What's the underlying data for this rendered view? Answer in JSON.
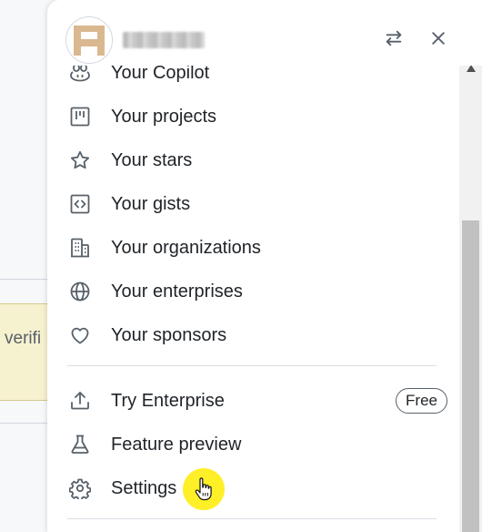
{
  "background": {
    "banner_text": "verifi"
  },
  "header": {
    "username": "",
    "switch_icon": "arrows-switch-icon",
    "close_icon": "close-icon"
  },
  "menu": {
    "items": [
      {
        "label": "Your Copilot",
        "icon": "copilot-icon"
      },
      {
        "label": "Your projects",
        "icon": "project-board-icon"
      },
      {
        "label": "Your stars",
        "icon": "star-icon"
      },
      {
        "label": "Your gists",
        "icon": "code-square-icon"
      },
      {
        "label": "Your organizations",
        "icon": "organization-icon"
      },
      {
        "label": "Your enterprises",
        "icon": "globe-icon"
      },
      {
        "label": "Your sponsors",
        "icon": "heart-icon"
      }
    ],
    "items2": [
      {
        "label": "Try Enterprise",
        "icon": "upload-icon",
        "badge": "Free"
      },
      {
        "label": "Feature preview",
        "icon": "beaker-icon"
      },
      {
        "label": "Settings",
        "icon": "gear-icon"
      }
    ]
  },
  "colors": {
    "text": "#1f2328",
    "icon": "#57606a",
    "divider": "#d8dee4",
    "cursor_highlight": "#ffec00"
  }
}
